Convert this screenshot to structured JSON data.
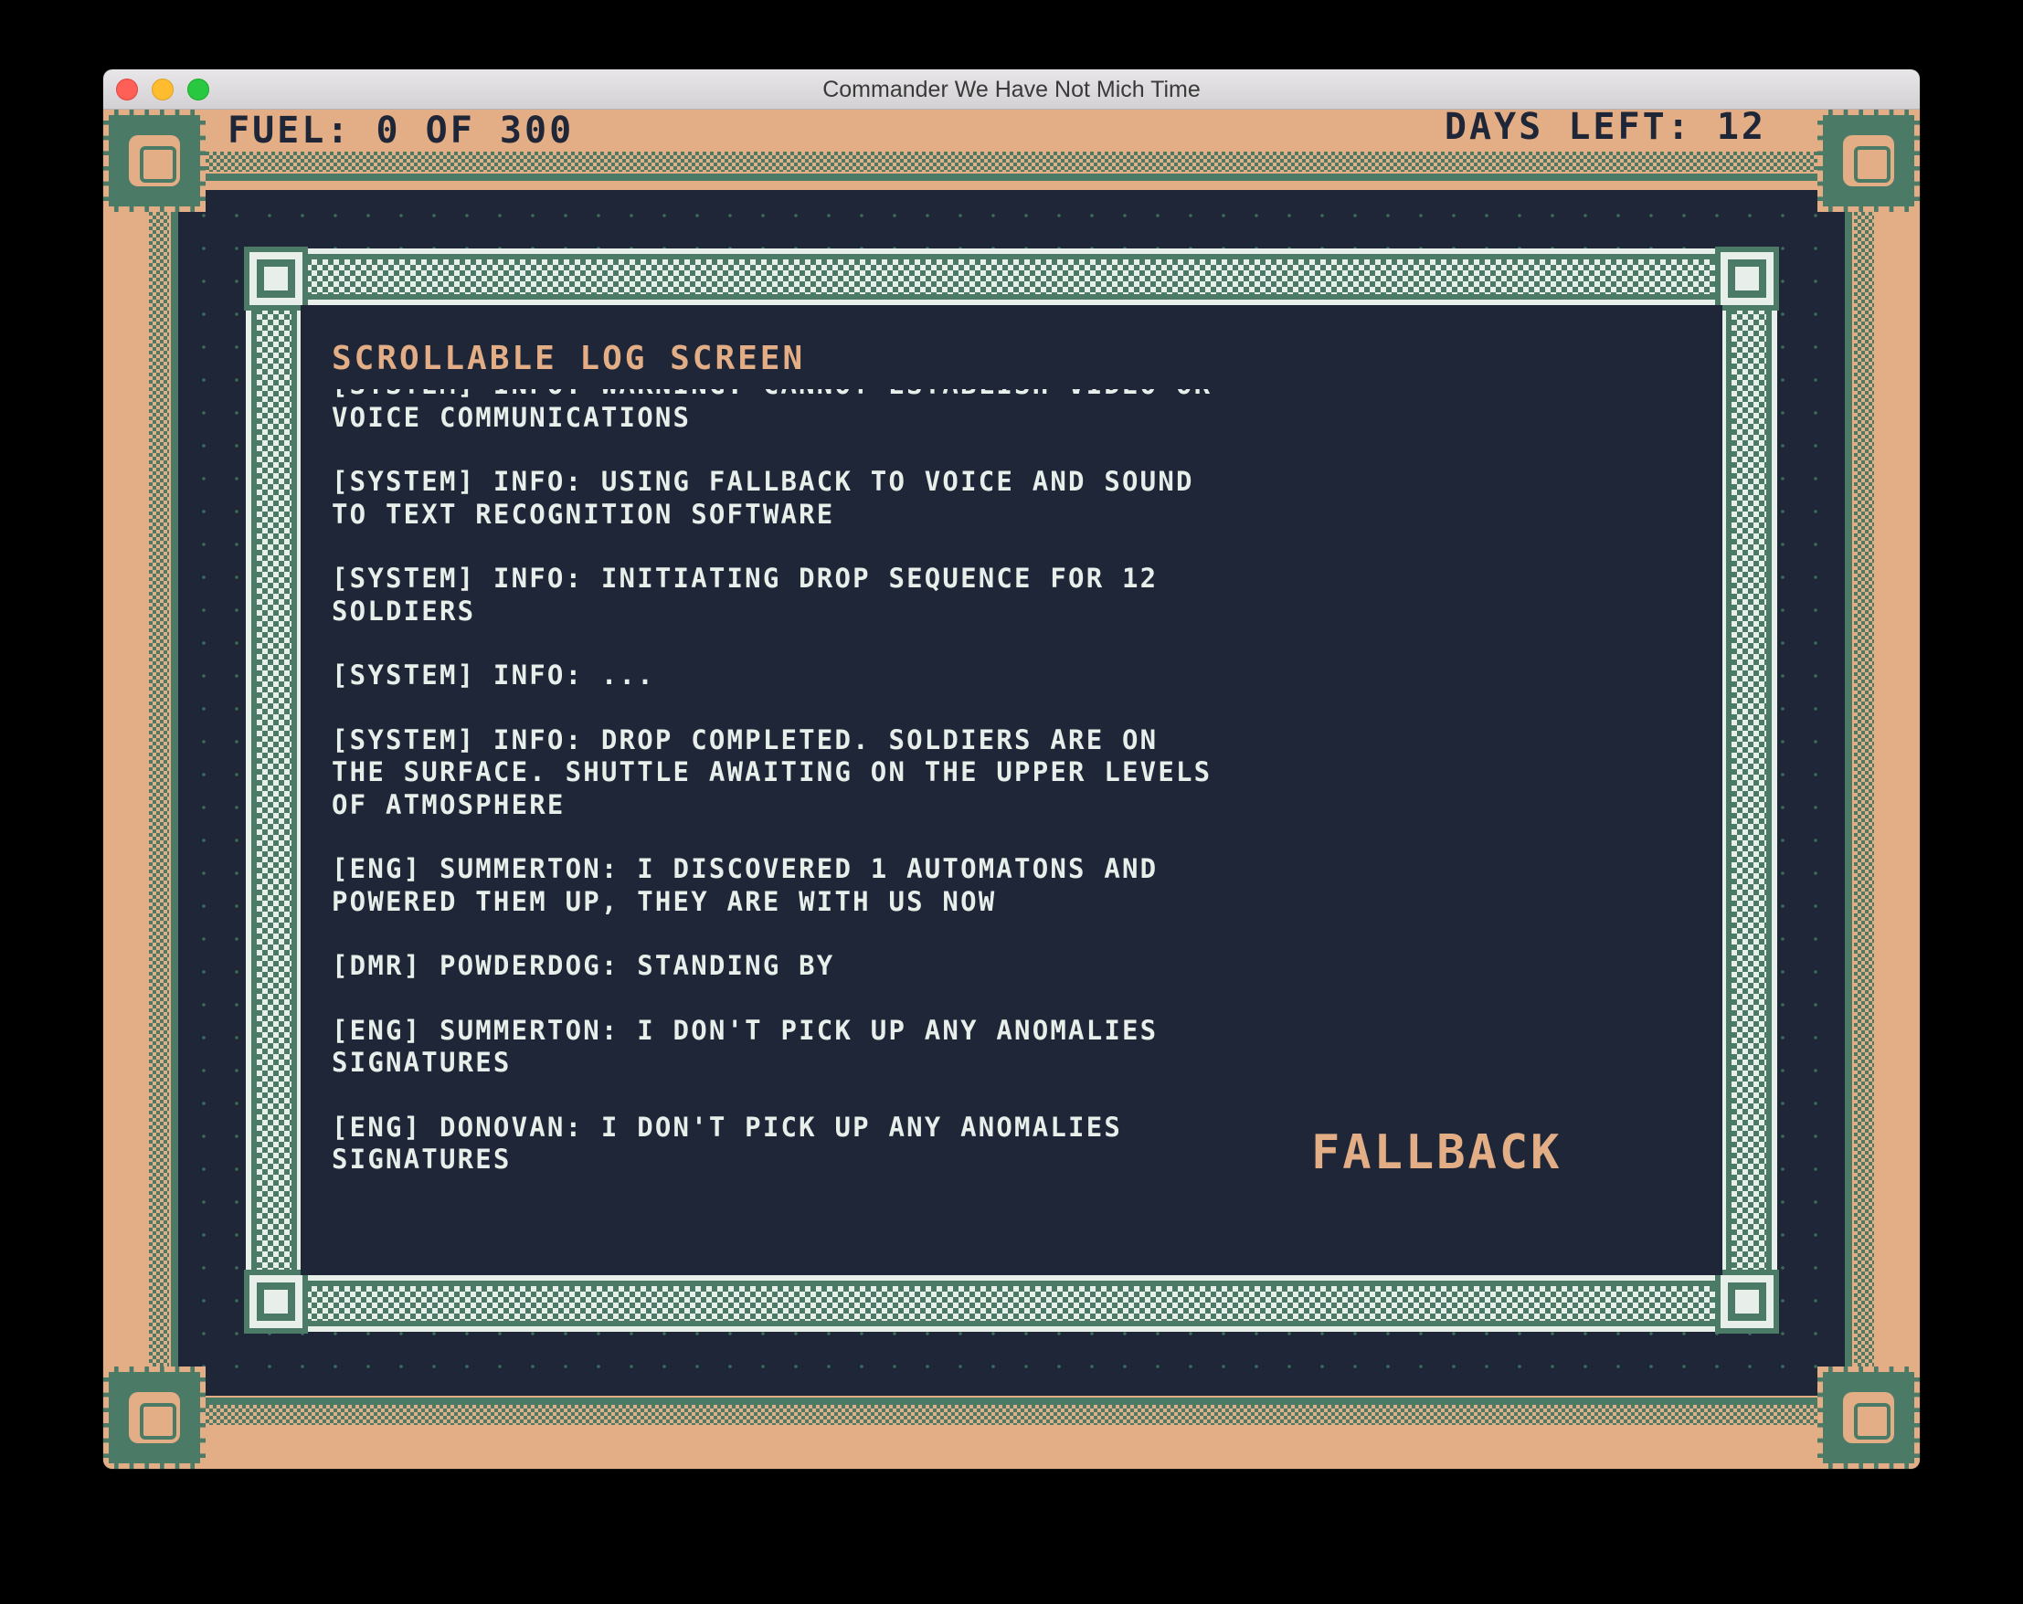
{
  "window": {
    "title": "Commander We Have Not Mich Time"
  },
  "hud": {
    "fuel": "FUEL: 0 OF 300",
    "days_left": "DAYS LEFT: 12"
  },
  "log_screen": {
    "heading": "SCROLLABLE LOG SCREEN",
    "entries": [
      "[SYSTEM] INFO: WARNING: CANNOT ESTABLISH VIDEO OR VOICE COMMUNICATIONS",
      "[SYSTEM] INFO: USING FALLBACK TO VOICE AND SOUND TO TEXT RECOGNITION SOFTWARE",
      "[SYSTEM] INFO: INITIATING DROP SEQUENCE FOR 12 SOLDIERS",
      "[SYSTEM] INFO: ...",
      "[SYSTEM] INFO: DROP COMPLETED. SOLDIERS ARE ON THE SURFACE. SHUTTLE AWAITING ON THE UPPER LEVELS OF ATMOSPHERE",
      "[ENG] SUMMERTON: I DISCOVERED 1 AUTOMATONS AND POWERED THEM UP, THEY ARE WITH US NOW",
      "[DMR] POWDERDOG: STANDING BY",
      "[ENG] SUMMERTON: I DON'T PICK UP ANY ANOMALIES SIGNATURES",
      "[ENG] DONOVAN: I DON'T PICK UP ANY ANOMALIES SIGNATURES"
    ],
    "fallback_label": "FALLBACK"
  },
  "colors": {
    "sand": "#e3ae85",
    "navy": "#1e2637",
    "green": "#4b7a66",
    "white": "#e8efea"
  }
}
